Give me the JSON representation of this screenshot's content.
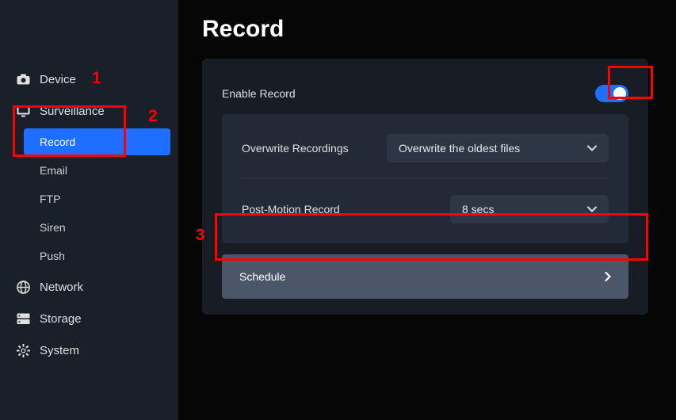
{
  "sidebar": {
    "items": [
      {
        "label": "Device"
      },
      {
        "label": "Surveillance"
      },
      {
        "label": "Network"
      },
      {
        "label": "Storage"
      },
      {
        "label": "System"
      }
    ],
    "surveillance_children": [
      {
        "label": "Record"
      },
      {
        "label": "Email"
      },
      {
        "label": "FTP"
      },
      {
        "label": "Siren"
      },
      {
        "label": "Push"
      }
    ]
  },
  "main": {
    "title": "Record",
    "enable_label": "Enable Record",
    "overwrite_label": "Overwrite Recordings",
    "overwrite_value": "Overwrite the oldest files",
    "postmotion_label": "Post-Motion Record",
    "postmotion_value": "8 secs",
    "schedule_label": "Schedule"
  },
  "annotations": {
    "n1": "1",
    "n2": "2",
    "n3": "3"
  }
}
